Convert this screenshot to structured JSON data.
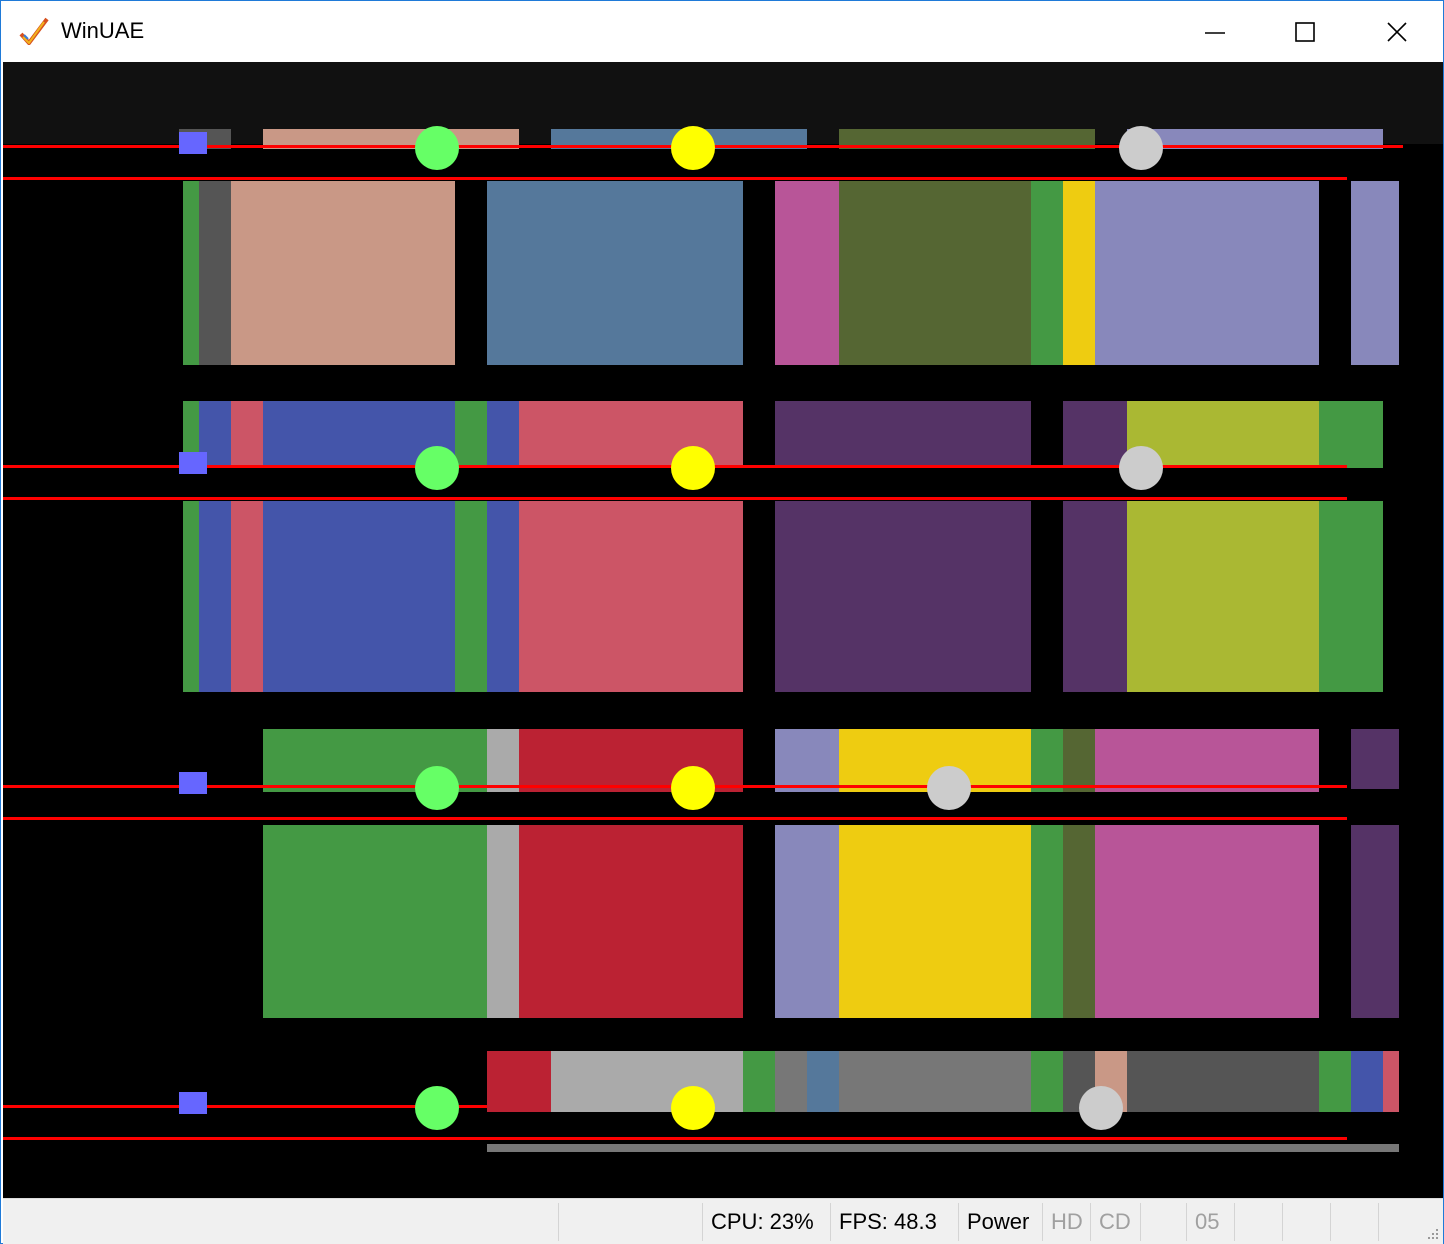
{
  "window": {
    "title": "WinUAE",
    "icon": "winuae-checkmark-icon"
  },
  "titlebar_buttons": {
    "minimize": "minimize-icon",
    "maximize": "maximize-icon",
    "close": "close-icon"
  },
  "emulator": {
    "description_colors": {
      "background": "#000000",
      "red_line": "#ff0000"
    }
  },
  "statusbar": {
    "cpu": "CPU: 23%",
    "fps": "FPS: 48.3",
    "power": "Power",
    "hd": "HD",
    "cd": "CD",
    "drive": "05"
  }
}
